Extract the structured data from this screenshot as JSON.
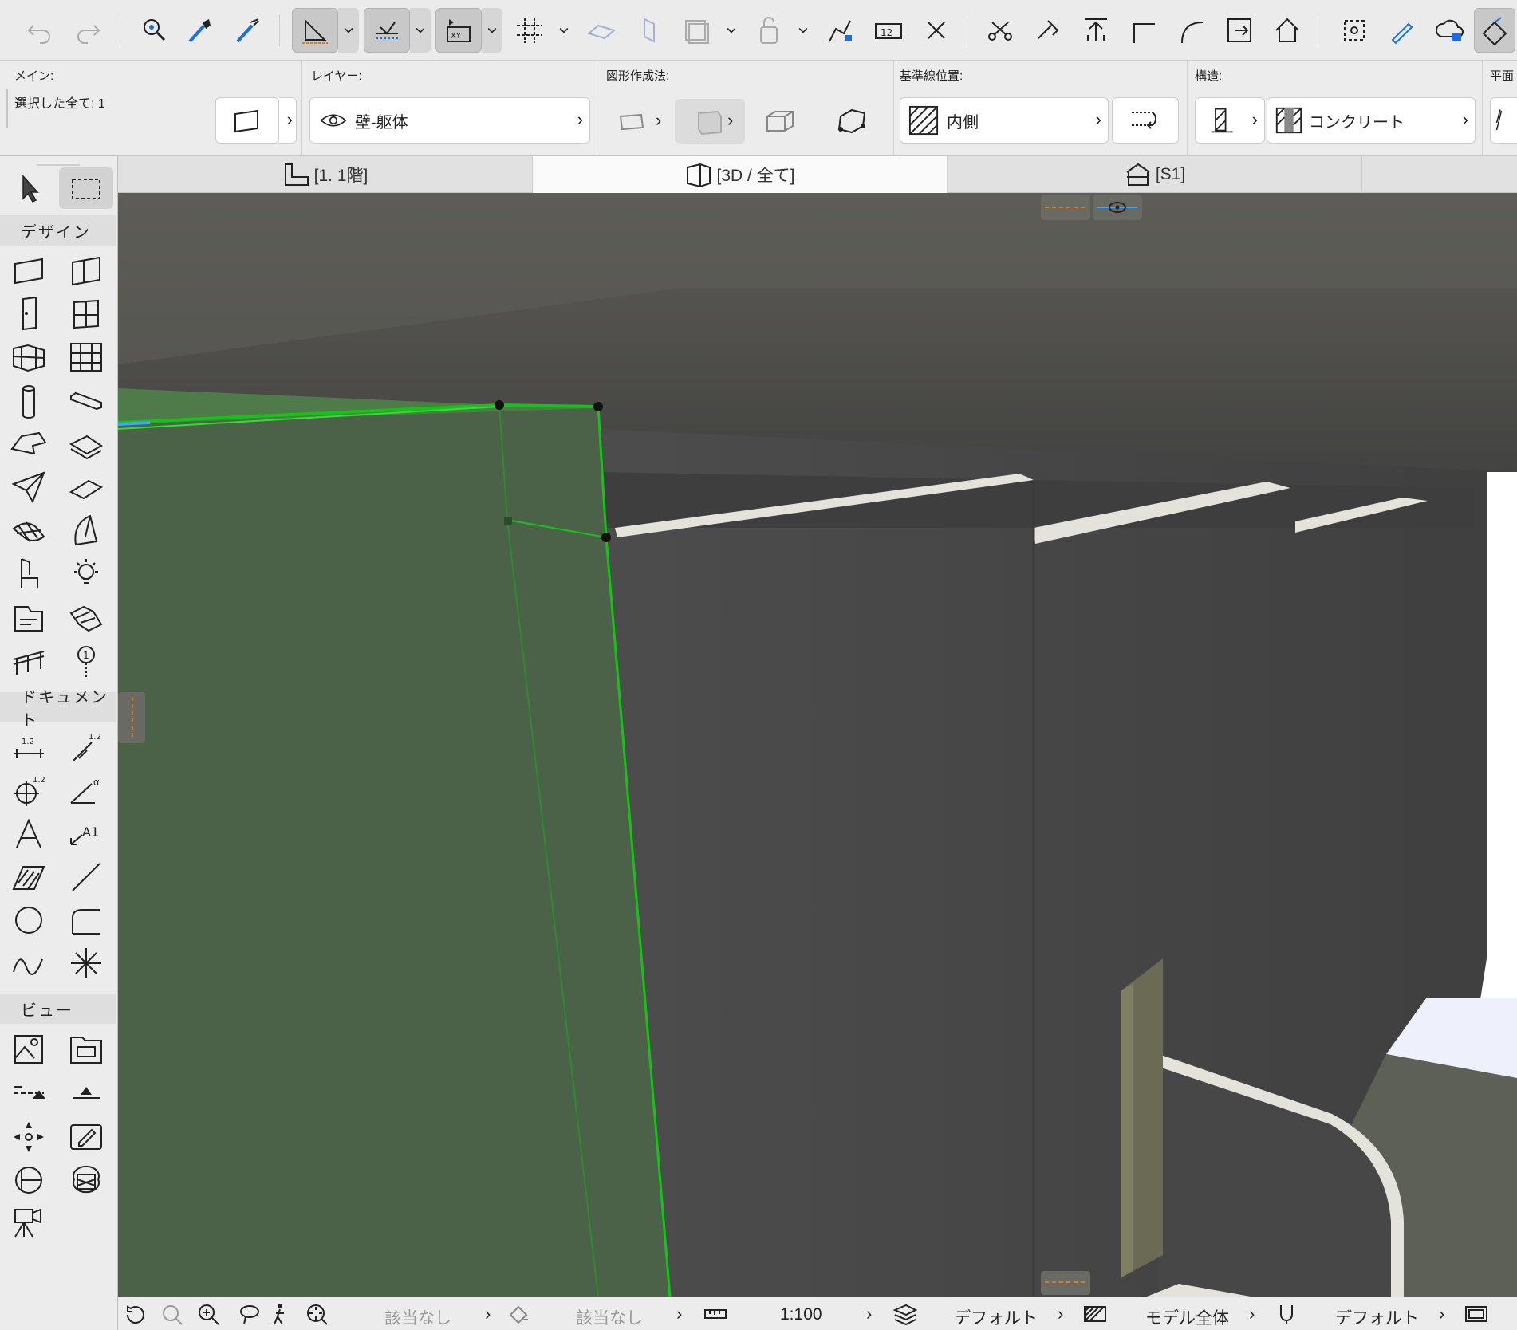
{
  "tabs": [
    {
      "label": "[1. 1階]",
      "icon": "floor-plan-icon"
    },
    {
      "label": "[3D / 全て]",
      "icon": "3d-window-icon"
    },
    {
      "label": "[S1]",
      "icon": "section-icon"
    }
  ],
  "active_tab": 1,
  "infobox": {
    "main_title": "メイン:",
    "selection_text": "選択した全て: 1",
    "layer_title": "レイヤー:",
    "layer_value": "壁-躯体",
    "geometry_title": "図形作成法:",
    "reference_title": "基準線位置:",
    "reference_value": "内側",
    "structure_title": "構造:",
    "structure_value": "コンクリート",
    "floorplan_title": "平面"
  },
  "toolbox": {
    "categories": [
      "デザイン",
      "ドキュメント",
      "ビュー"
    ]
  },
  "statusbar": {
    "none_1": "該当なし",
    "none_2": "該当なし",
    "scale": "1:100",
    "layer_combo": "デフォルト",
    "model_view": "モデル全体",
    "pen_set": "デフォルト"
  },
  "colors": {
    "selection_green": "#14c414",
    "wall_dark": "#4a4a4a",
    "selected_fill": "#4b6249",
    "slab_edge": "#e3e3dc"
  }
}
